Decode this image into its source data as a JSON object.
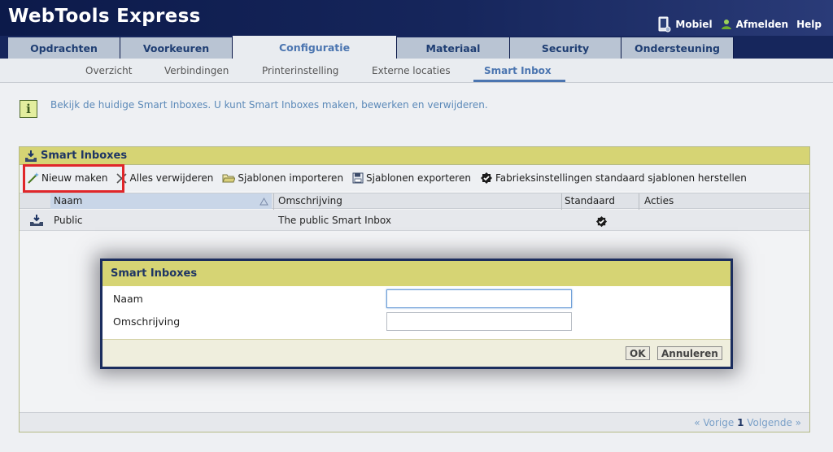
{
  "app": {
    "title": "WebTools Express"
  },
  "top_links": {
    "mobile": "Mobiel",
    "logout": "Afmelden",
    "help": "Help"
  },
  "tabs": [
    {
      "label": "Opdrachten"
    },
    {
      "label": "Voorkeuren"
    },
    {
      "label": "Configuratie",
      "active": true
    },
    {
      "label": "Materiaal"
    },
    {
      "label": "Security"
    },
    {
      "label": "Ondersteuning"
    }
  ],
  "subtabs": [
    {
      "label": "Overzicht"
    },
    {
      "label": "Verbindingen"
    },
    {
      "label": "Printerinstelling"
    },
    {
      "label": "Externe locaties"
    },
    {
      "label": "Smart Inbox",
      "active": true
    }
  ],
  "info": {
    "text": "Bekijk de huidige Smart Inboxes. U kunt Smart Inboxes maken, bewerken en verwijderen."
  },
  "panel": {
    "title": "Smart Inboxes",
    "toolbar": {
      "new": "Nieuw maken",
      "delete_all": "Alles verwijderen",
      "import": "Sjablonen importeren",
      "export": "Sjablonen exporteren",
      "restore": "Fabrieksinstellingen standaard sjablonen herstellen"
    },
    "columns": {
      "name": "Naam",
      "description": "Omschrijving",
      "default": "Standaard",
      "actions": "Acties"
    },
    "rows": [
      {
        "name": "Public",
        "description": "The public Smart Inbox",
        "is_default": true
      }
    ],
    "pager": {
      "prev": "« Vorige",
      "page": "1",
      "next": "Volgende »"
    }
  },
  "dialog": {
    "title": "Smart Inboxes",
    "name_label": "Naam",
    "name_value": "",
    "description_label": "Omschrijving",
    "description_value": "",
    "ok": "OK",
    "cancel": "Annuleren"
  },
  "colors": {
    "header": "#16265c",
    "panel_header": "#d6d474",
    "highlight": "#e0262a",
    "link": "#4b75b0"
  }
}
